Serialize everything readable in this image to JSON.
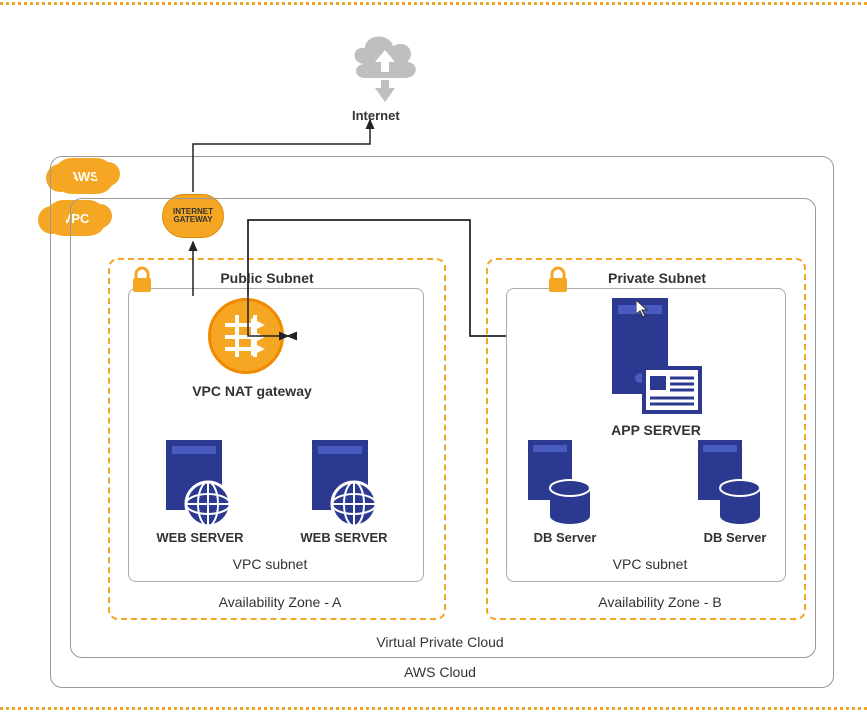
{
  "internet": {
    "label": "Internet"
  },
  "badges": {
    "aws": "AWS",
    "vpc": "VPC",
    "igw": "INTERNET GATEWAY"
  },
  "zones": {
    "a": {
      "subnetType": "Public Subnet",
      "natLabel": "VPC NAT gateway",
      "web1": "WEB SERVER",
      "web2": "WEB SERVER",
      "vpcSubnet": "VPC subnet",
      "azLabel": "Availability Zone - A"
    },
    "b": {
      "subnetType": "Private Subnet",
      "appServer": "APP SERVER",
      "db1": "DB Server",
      "db2": "DB Server",
      "vpcSubnet": "VPC subnet",
      "azLabel": "Availability Zone - B"
    }
  },
  "containers": {
    "vpc": "Virtual Private Cloud",
    "aws": "AWS Cloud"
  }
}
